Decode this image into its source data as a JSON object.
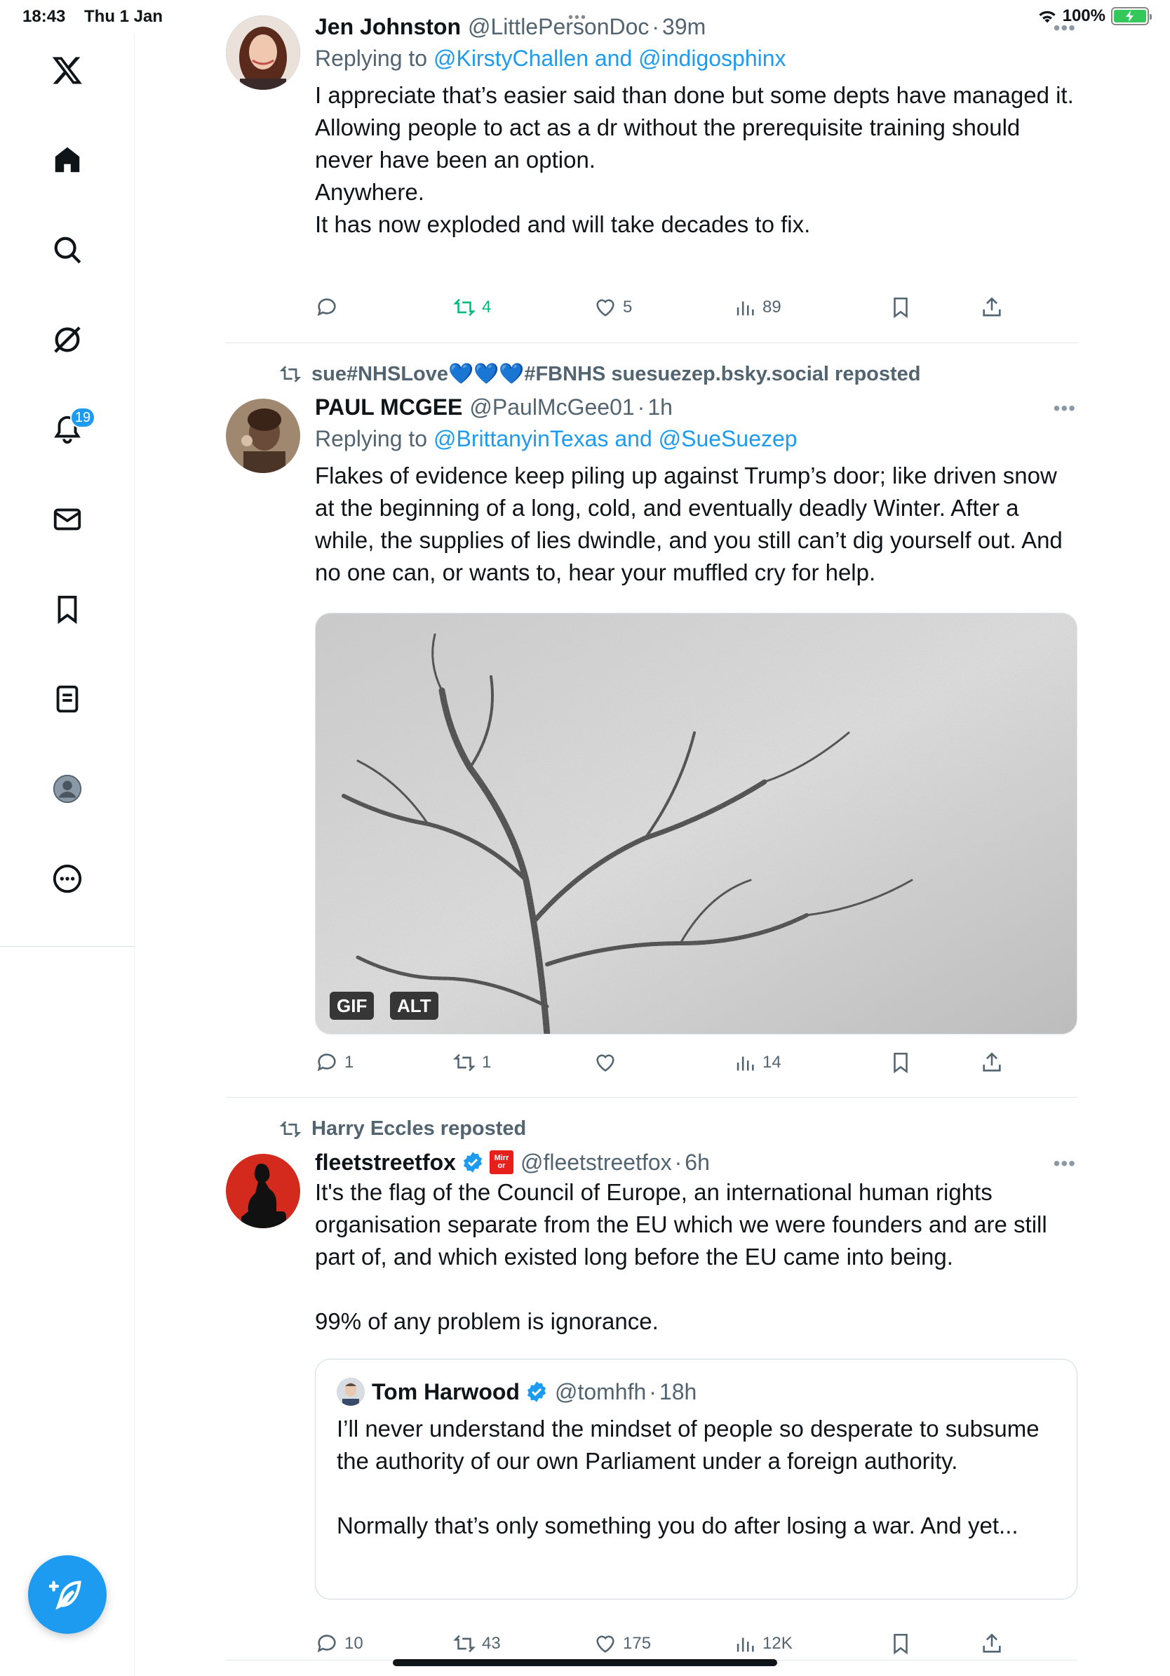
{
  "statusbar": {
    "time": "18:43",
    "date": "Thu 1 Jan",
    "battery": "100%"
  },
  "sidebar": {
    "notifications_badge": "19"
  },
  "tweets": [
    {
      "name": "Jen Johnston",
      "handle": "@LittlePersonDoc",
      "time": "39m",
      "replying_prefix": "Replying to ",
      "replying_to": "@KirstyChallen and @indigosphinx",
      "body": "I appreciate that’s easier said than done but some depts have managed it.\nAllowing people to act as a dr without the prerequisite training should never have been an option.\nAnywhere.\nIt has now exploded and will take decades to fix.",
      "replies": "",
      "reposts": "4",
      "likes": "5",
      "views": "89"
    },
    {
      "repost_by": "sue#NHSLove💙💙💙#FBNHS suesuezep.bsky.social reposted",
      "name": "PAUL MCGEE",
      "handle": "@PaulMcGee01",
      "time": "1h",
      "replying_prefix": "Replying to ",
      "replying_to": "@BrittanyinTexas and @SueSuezep",
      "body": "Flakes of evidence keep piling up against Trump’s door; like driven snow at the beginning of a long, cold, and eventually deadly Winter. After a while, the supplies of lies dwindle, and you still can’t dig yourself out. And no one can, or wants to, hear your muffled cry for help.",
      "media_tags": [
        "GIF",
        "ALT"
      ],
      "replies": "1",
      "reposts": "1",
      "likes": "",
      "views": "14"
    },
    {
      "repost_by": "Harry Eccles reposted",
      "name": "fleetstreetfox",
      "handle": "@fleetstreetfox",
      "time": "6h",
      "affiliate_badge": "Mirror",
      "body": "It's the flag of the Council of Europe, an international human rights organisation separate from the EU which we were founders and are still part of, and which existed long before the EU came into being.\n\n99% of any problem is ignorance.",
      "quote": {
        "name": "Tom Harwood",
        "handle": "@tomhfh",
        "time": "18h",
        "body": "I’ll never understand the mindset of people so desperate to subsume the authority of our own Parliament under a foreign authority.\n\nNormally that’s only something you do after losing a war. And yet..."
      },
      "replies": "10",
      "reposts": "43",
      "likes": "175",
      "views": "12K"
    }
  ],
  "colors": {
    "accent": "#1d9bf0",
    "repost_green": "#00ba7c",
    "secondary_text": "#536471"
  }
}
